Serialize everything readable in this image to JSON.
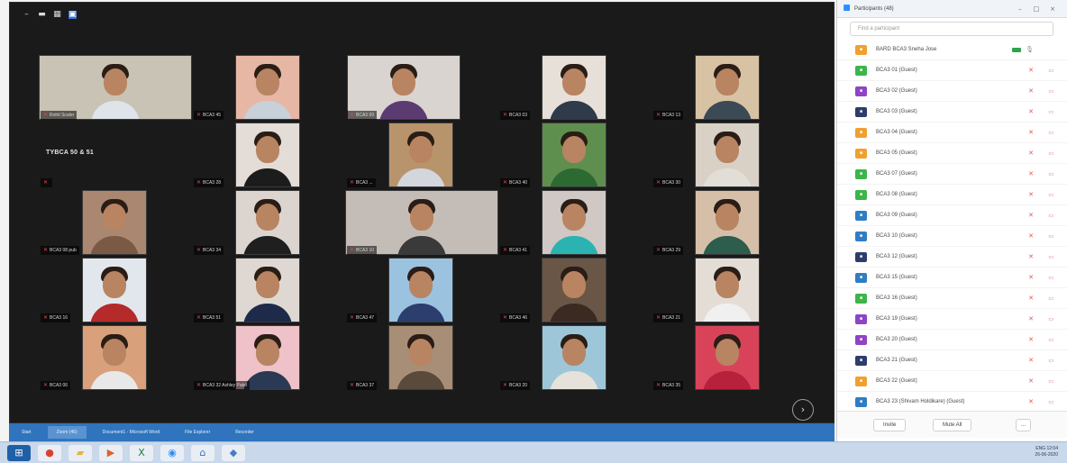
{
  "meeting": {
    "toolbar_icons": [
      {
        "name": "minimize-icon",
        "glyph": "–"
      },
      {
        "name": "view-icon",
        "glyph": "▬"
      },
      {
        "name": "grid-icon",
        "glyph": "▦"
      },
      {
        "name": "gallery-view-icon",
        "glyph": "▣"
      }
    ],
    "text_tile": "TYBCA 50 & 51",
    "next_page_glyph": "›",
    "tiles": [
      {
        "label": "Rohit Scaler",
        "kind": "wide",
        "bg": "#c9c3b6",
        "shirt": "#dfe4ea"
      },
      {
        "label": "BCA3 45",
        "kind": "narrow",
        "bg": "#e7b7a6",
        "shirt": "#c8d0d8"
      },
      {
        "label": "BCA3 09",
        "kind": "wide2",
        "bg": "#d9d4cf",
        "shirt": "#5c3b72"
      },
      {
        "label": "BCA3 03",
        "kind": "narrow",
        "bg": "#e6e0d8",
        "shirt": "#2f3a4a"
      },
      {
        "label": "BCA3 13",
        "kind": "narrow",
        "bg": "#d8c2a4",
        "shirt": "#3c4a55"
      },
      {
        "label": "",
        "kind": "text",
        "bg": "#1a1a1a",
        "shirt": "#1a1a1a"
      },
      {
        "label": "BCA3 28",
        "kind": "narrow",
        "bg": "#e3dcd7",
        "shirt": "#1c1c1c"
      },
      {
        "label": "BCA3 ...",
        "kind": "narrow",
        "bg": "#b8946c",
        "shirt": "#d3d6dc"
      },
      {
        "label": "BCA3 40",
        "kind": "narrow",
        "bg": "#5f8f4e",
        "shirt": "#2d6a31"
      },
      {
        "label": "BCA3 30",
        "kind": "narrow",
        "bg": "#d9d1c6",
        "shirt": "#e2ddd6"
      },
      {
        "label": "BCA3 08 pub",
        "kind": "narrow",
        "bg": "#a98770",
        "shirt": "#7a5a44"
      },
      {
        "label": "BCA3 34",
        "kind": "narrow",
        "bg": "#dcd5cf",
        "shirt": "#1f1f1f"
      },
      {
        "label": "BCA3 10",
        "kind": "wide",
        "bg": "#c4bdb7",
        "shirt": "#3a3a3a"
      },
      {
        "label": "BCA3 41",
        "kind": "narrow",
        "bg": "#cfc8c4",
        "shirt": "#2bb3b1"
      },
      {
        "label": "BCA3 29",
        "kind": "narrow",
        "bg": "#d6bfa8",
        "shirt": "#2d5d4c"
      },
      {
        "label": "BCA3 16",
        "kind": "narrow",
        "bg": "#e2e7ee",
        "shirt": "#b52a2a"
      },
      {
        "label": "BCA3 51",
        "kind": "narrow",
        "bg": "#dfd8d2",
        "shirt": "#1e2a4a"
      },
      {
        "label": "BCA3 47",
        "kind": "narrow",
        "bg": "#9bc3e0",
        "shirt": "#2c3e6e"
      },
      {
        "label": "BCA3 46",
        "kind": "narrow",
        "bg": "#6a5646",
        "shirt": "#3a2a22"
      },
      {
        "label": "BCA3 21",
        "kind": "narrow",
        "bg": "#e4ddd6",
        "shirt": "#f0f0f0"
      },
      {
        "label": "BCA3 06",
        "kind": "narrow",
        "bg": "#d9a07c",
        "shirt": "#e8e8e8"
      },
      {
        "label": "BCA3 32 Ashley Patel",
        "kind": "narrow",
        "bg": "#eec2c8",
        "shirt": "#2a3a54"
      },
      {
        "label": "BCA3 37",
        "kind": "narrow",
        "bg": "#a88e76",
        "shirt": "#5a4a3c"
      },
      {
        "label": "BCA3 20",
        "kind": "narrow",
        "bg": "#9dc7d8",
        "shirt": "#e7e1dc"
      },
      {
        "label": "BCA3 35",
        "kind": "narrow",
        "bg": "#d9435a",
        "shirt": "#b8213b"
      }
    ]
  },
  "panel": {
    "title": "Participants (48)",
    "search_placeholder": "Find a participant",
    "participants": [
      {
        "name": "BARD BCA3 Sneha Jose",
        "color": "#f0a030",
        "mode": "host"
      },
      {
        "name": "BCA3 01 (Guest)",
        "color": "#3cb54a",
        "mode": "muted"
      },
      {
        "name": "BCA3 02 (Guest)",
        "color": "#8e44c4",
        "mode": "muted"
      },
      {
        "name": "BCA3 03 (Guest)",
        "color": "#2d3e6c",
        "mode": "muted"
      },
      {
        "name": "BCA3 04 (Guest)",
        "color": "#f0a030",
        "mode": "muted"
      },
      {
        "name": "BCA3 05 (Guest)",
        "color": "#f0a030",
        "mode": "muted"
      },
      {
        "name": "BCA3 07 (Guest)",
        "color": "#3cb54a",
        "mode": "muted"
      },
      {
        "name": "BCA3 08 (Guest)",
        "color": "#3cb54a",
        "mode": "muted"
      },
      {
        "name": "BCA3 09 (Guest)",
        "color": "#2f7ec4",
        "mode": "muted"
      },
      {
        "name": "BCA3 10 (Guest)",
        "color": "#2f7ec4",
        "mode": "muted"
      },
      {
        "name": "BCA3 12 (Guest)",
        "color": "#2d3e6c",
        "mode": "muted"
      },
      {
        "name": "BCA3 15 (Guest)",
        "color": "#2f7ec4",
        "mode": "muted"
      },
      {
        "name": "BCA3 16 (Guest)",
        "color": "#3cb54a",
        "mode": "muted"
      },
      {
        "name": "BCA3 19 (Guest)",
        "color": "#8e44c4",
        "mode": "muted"
      },
      {
        "name": "BCA3 20 (Guest)",
        "color": "#8e44c4",
        "mode": "muted"
      },
      {
        "name": "BCA3 21 (Guest)",
        "color": "#2d3e6c",
        "mode": "muted"
      },
      {
        "name": "BCA3 22 (Guest)",
        "color": "#f0a030",
        "mode": "muted"
      },
      {
        "name": "BCA3 23 (Shivam Holdikare) (Guest)",
        "color": "#2f7ec4",
        "mode": "muted"
      }
    ],
    "invite_label": "Invite",
    "mute_all_label": "Mute All",
    "more_label": "..."
  },
  "apps_strip": [
    {
      "label": "Start",
      "active": false
    },
    {
      "label": "Zoom (46)",
      "active": true
    },
    {
      "label": "Document1 - Microsoft Word",
      "active": false
    },
    {
      "label": "File Explorer",
      "active": false
    },
    {
      "label": "Recorder",
      "active": false
    }
  ],
  "taskbar": {
    "icons": [
      {
        "name": "start-icon",
        "glyph": "⊞",
        "bg": "#1f5fa8",
        "color": "#ffffff"
      },
      {
        "name": "chrome-icon",
        "glyph": "●",
        "bg": "#e9eef5",
        "color": "#d8432f"
      },
      {
        "name": "folder-icon",
        "glyph": "▰",
        "bg": "#e9eef5",
        "color": "#e8b43a"
      },
      {
        "name": "media-icon",
        "glyph": "▶",
        "bg": "#e9eef5",
        "color": "#e0622a"
      },
      {
        "name": "excel-icon",
        "glyph": "X",
        "bg": "#e9eef5",
        "color": "#1f7a3e"
      },
      {
        "name": "zoom-icon",
        "glyph": "◉",
        "bg": "#e9eef5",
        "color": "#2d8cff"
      },
      {
        "name": "network-icon",
        "glyph": "⌂",
        "bg": "#e9eef5",
        "color": "#3a6fb0"
      },
      {
        "name": "shield-icon",
        "glyph": "◆",
        "bg": "#e9eef5",
        "color": "#4a7bc8"
      }
    ],
    "tray_line1": "ENG 12:04",
    "tray_line2": "26-06-2020"
  },
  "colors": {
    "meeting_bg": "#1a1a1a",
    "panel_bg": "#ffffff",
    "muted_red": "#e05555",
    "strip_blue": "#2f74bd"
  }
}
